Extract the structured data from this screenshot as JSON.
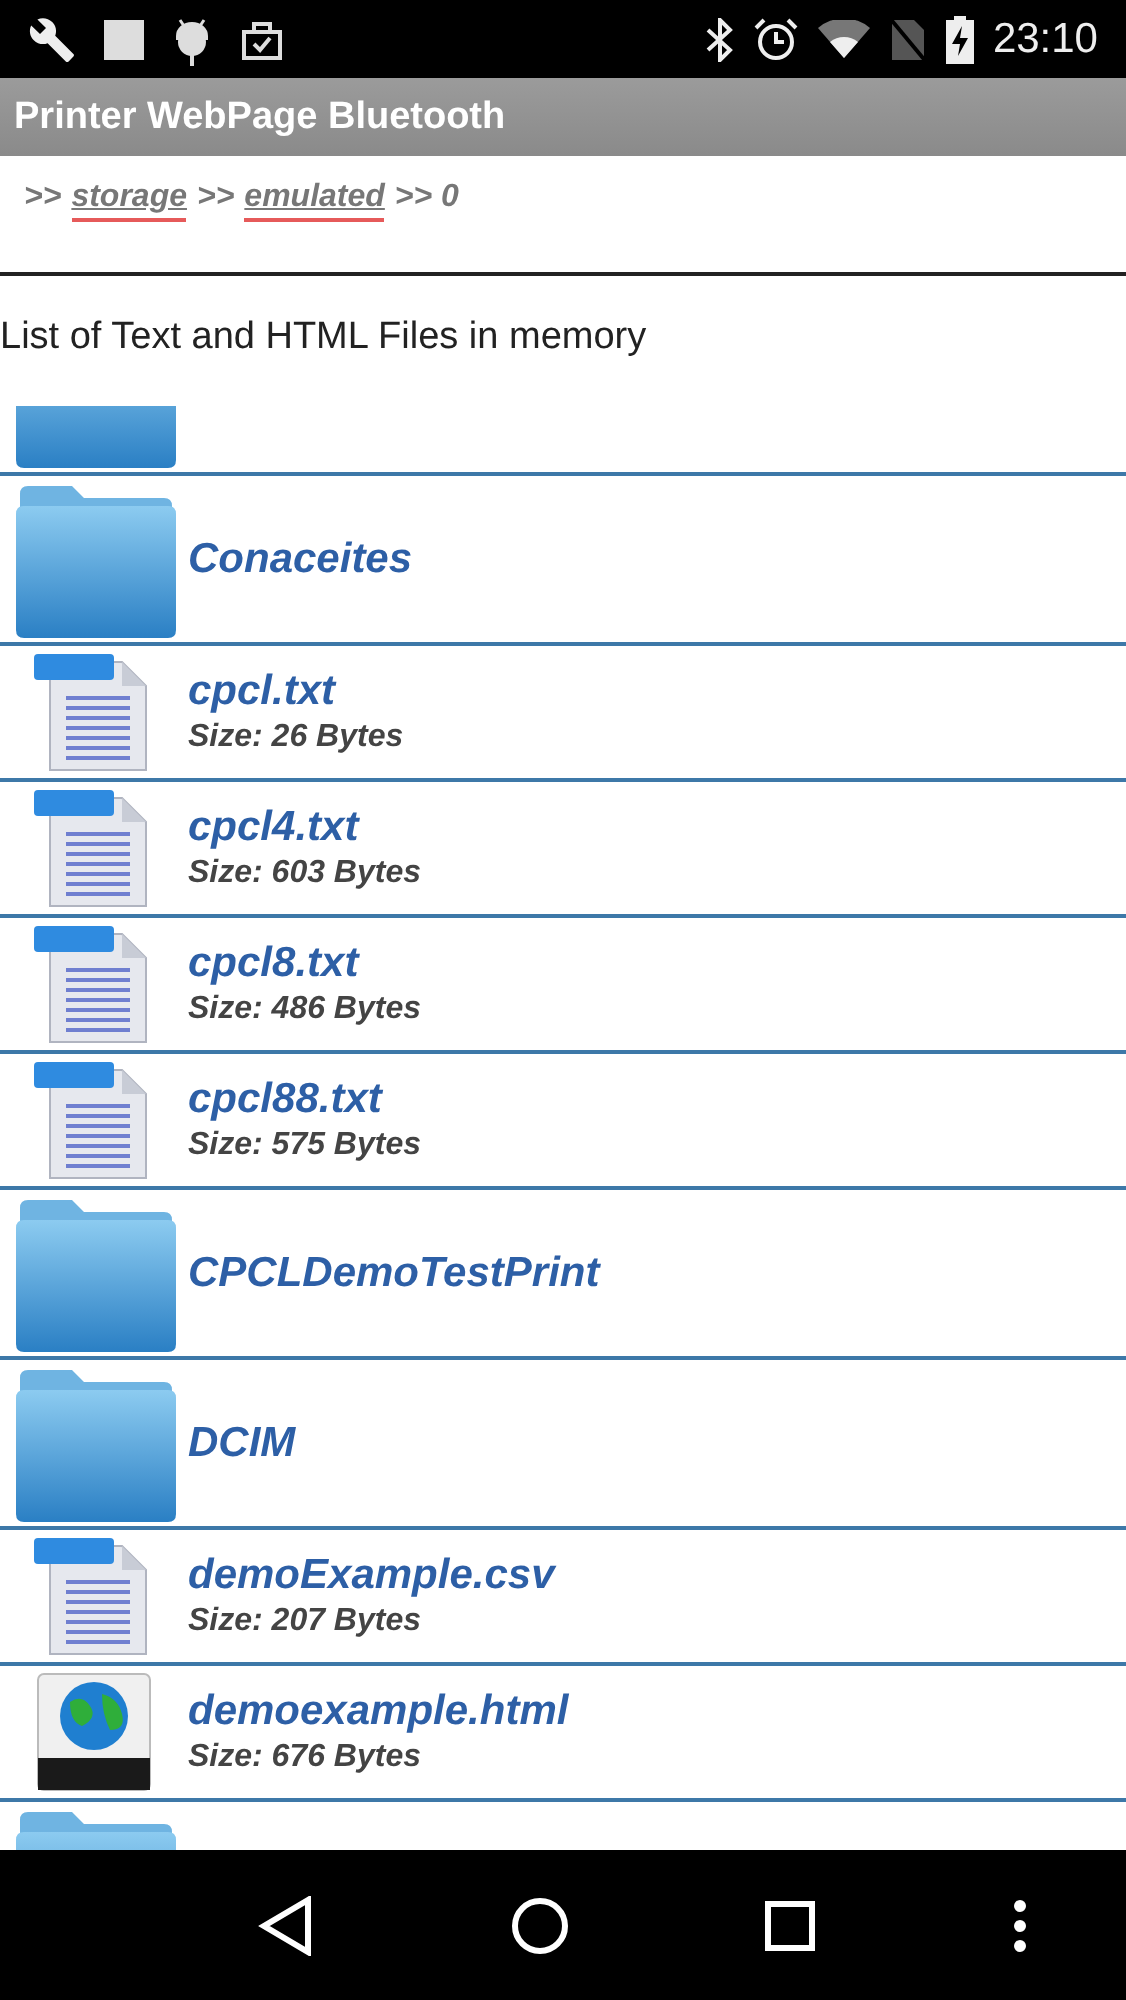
{
  "status_bar": {
    "time": "23:10"
  },
  "title": "Printer WebPage Bluetooth",
  "breadcrumb": [
    {
      "text": ">>",
      "link": false,
      "misspelled": false
    },
    {
      "text": "storage",
      "link": true,
      "misspelled": true
    },
    {
      "text": ">>",
      "link": false,
      "misspelled": false
    },
    {
      "text": "emulated",
      "link": true,
      "misspelled": true
    },
    {
      "text": ">> 0",
      "link": false,
      "misspelled": false
    }
  ],
  "heading": "List of Text and HTML Files in memory",
  "files": [
    {
      "kind": "folder"
    },
    {
      "kind": "folder",
      "name": "Conaceites"
    },
    {
      "kind": "text",
      "name": "cpcl.txt",
      "size": "Size: 26 Bytes"
    },
    {
      "kind": "text",
      "name": "cpcl4.txt",
      "size": "Size: 603 Bytes"
    },
    {
      "kind": "text",
      "name": "cpcl8.txt",
      "size": "Size: 486 Bytes"
    },
    {
      "kind": "text",
      "name": "cpcl88.txt",
      "size": "Size: 575 Bytes"
    },
    {
      "kind": "folder",
      "name": "CPCLDemoTestPrint"
    },
    {
      "kind": "folder",
      "name": "DCIM"
    },
    {
      "kind": "text",
      "name": "demoExample.csv",
      "size": "Size: 207 Bytes"
    },
    {
      "kind": "html",
      "name": "demoexample.html",
      "size": "Size: 676 Bytes"
    },
    {
      "kind": "folder"
    }
  ]
}
